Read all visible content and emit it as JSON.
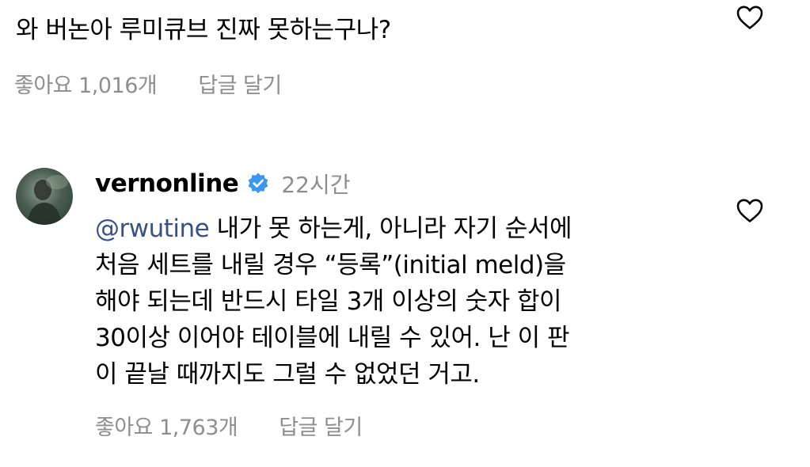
{
  "top_comment": {
    "text": "와 버논아 루미큐브 진짜 못하는구나?",
    "likes_label": "좋아요 1,016개",
    "reply_label": "답글 달기",
    "like_icon": "heart-outline-icon"
  },
  "reply": {
    "avatar_icon": "profile-photo",
    "username": "vernonline",
    "verified_icon": "verified-badge-icon",
    "verified_color": "#3897f0",
    "time": "22시간",
    "mention": "@rwutine",
    "lines": {
      "l1_rest": " 내가 못 하는게, 아니라 자기 순서에",
      "l2": "처음 세트를 내릴 경우 “등록”(initial meld)을",
      "l3": "해야 되는데 반드시 타일 3개 이상의 숫자 합이",
      "l4": "30이상 이어야 테이블에 내릴 수 있어. 난 이 판",
      "l5": "이 끝날 때까지도 그럴 수 없었던 거고."
    },
    "likes_label": "좋아요 1,763개",
    "reply_label": "답글 달기",
    "like_icon": "heart-outline-icon"
  },
  "colors": {
    "text": "#000000",
    "meta": "#8e8e8e",
    "mention": "#385185"
  }
}
